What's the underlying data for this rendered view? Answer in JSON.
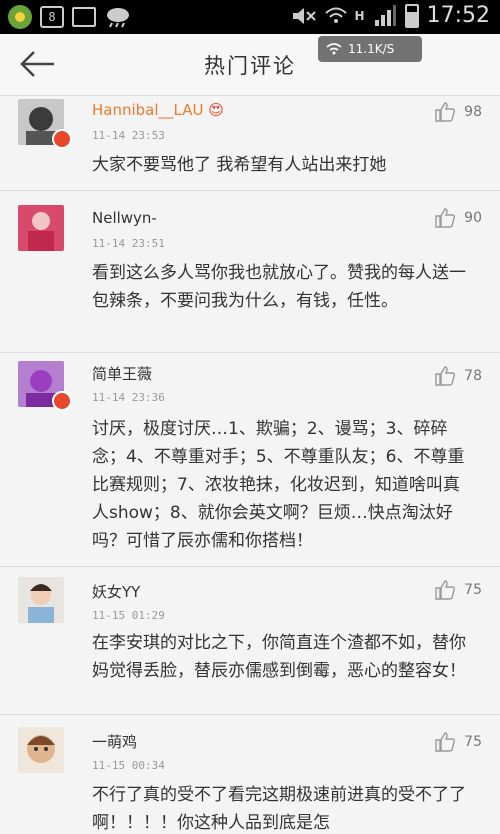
{
  "status_bar": {
    "badge": "8",
    "signal_type": "H",
    "time": "17:52"
  },
  "header": {
    "title": "热门评论",
    "speed": "11.1K/S",
    "back_icon": "arrow-left-icon"
  },
  "comments": [
    {
      "name": "Hannibal__LAU",
      "time": "11-14 23:53",
      "likes": "98",
      "text": "大家不要骂他了 我希望有人站出来打她"
    },
    {
      "name": "Nellwyn-",
      "time": "11-14 23:51",
      "likes": "90",
      "text": "看到这么多人骂你我也就放心了。赞我的每人送一包辣条，不要问我为什么，有钱，任性。"
    },
    {
      "name": "简单王薇",
      "time": "11-14 23:36",
      "likes": "78",
      "text": "讨厌，极度讨厌…1、欺骗；2、谩骂；3、碎碎念；4、不尊重对手；5、不尊重队友；6、不尊重比赛规则；7、浓妆艳抹，化妆迟到，知道啥叫真人show；8、就你会英文啊？巨烦…快点淘汰好吗？可惜了辰亦儒和你搭档！"
    },
    {
      "name": "妖女YY",
      "time": "11-15 01:29",
      "likes": "75",
      "text": "在李安琪的对比之下，你简直连个渣都不如，替你妈觉得丢脸，替辰亦儒感到倒霉，恶心的整容女！"
    },
    {
      "name": "一萌鸡",
      "time": "11-15 00:34",
      "likes": "75",
      "text": "不行了真的受不了看完这期极速前进真的受不了了啊！！！！你这种人品到底是怎"
    }
  ]
}
